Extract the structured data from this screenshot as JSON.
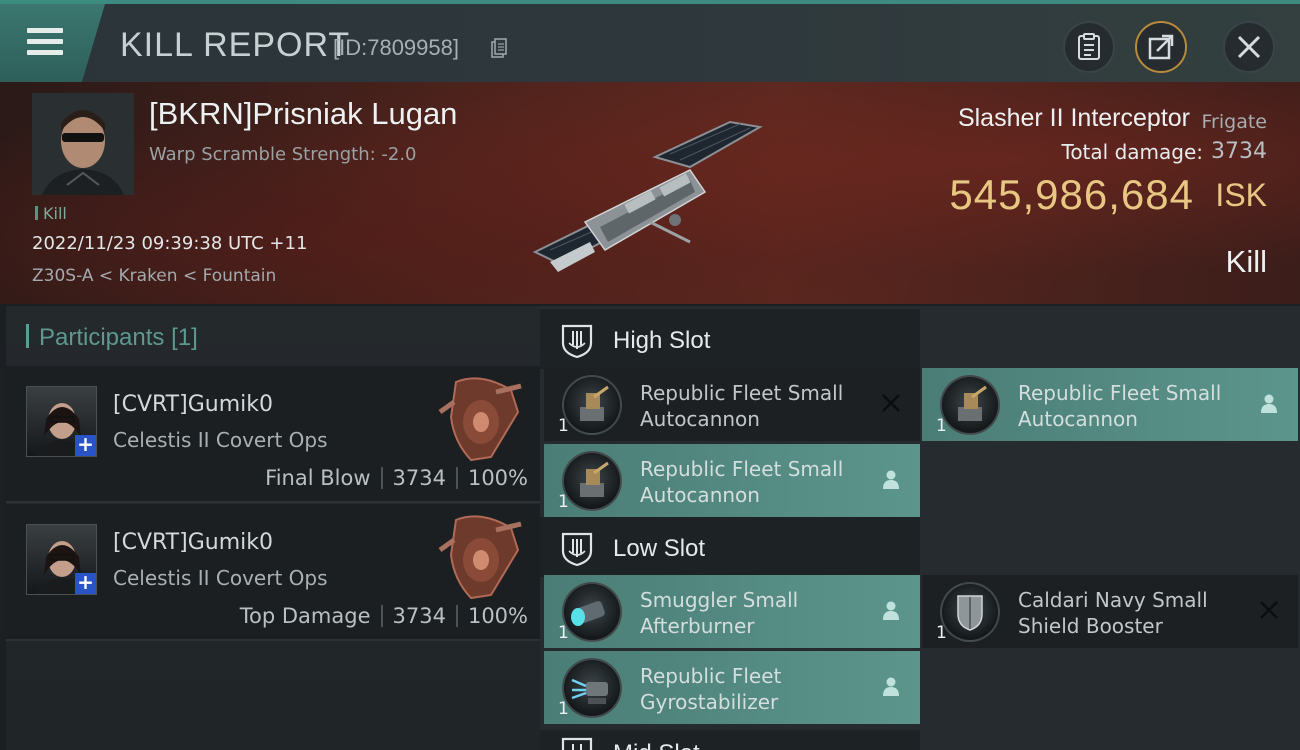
{
  "header": {
    "title": "KILL REPORT",
    "id_label": "[ID:7809958]"
  },
  "victim": {
    "name": "[BKRN]Prisniak Lugan",
    "scramble": "Warp Scramble Strength: -2.0",
    "kill_tag": "Kill",
    "datetime": "2022/11/23 09:39:38 UTC +11",
    "location": "Z30S-A < Kraken < Fountain",
    "ship_name": "Slasher II Interceptor",
    "ship_class": "Frigate",
    "total_damage_label": "Total damage:",
    "total_damage": "3734",
    "isk_value": "545,986,684",
    "isk_unit": "ISK",
    "result": "Kill"
  },
  "participants": {
    "title": "Participants",
    "count": "[1]",
    "rows": [
      {
        "name": "[CVRT]Gumik0",
        "ship": "Celestis II Covert Ops",
        "role": "Final Blow",
        "damage": "3734",
        "percent": "100%"
      },
      {
        "name": "[CVRT]Gumik0",
        "ship": "Celestis II Covert Ops",
        "role": "Top Damage",
        "damage": "3734",
        "percent": "100%"
      }
    ]
  },
  "slots": {
    "high": {
      "label": "High Slot",
      "modules": [
        {
          "qty": "1",
          "line1": "Republic Fleet Small",
          "line2": "Autocannon",
          "status": "destroyed"
        },
        {
          "qty": "1",
          "line1": "Republic Fleet Small",
          "line2": "Autocannon",
          "status": "dropped"
        },
        {
          "qty": "1",
          "line1": "Republic Fleet Small",
          "line2": "Autocannon",
          "status": "dropped"
        }
      ]
    },
    "low": {
      "label": "Low Slot",
      "modules": [
        {
          "qty": "1",
          "line1": "Smuggler Small",
          "line2": "Afterburner",
          "status": "dropped"
        },
        {
          "qty": "1",
          "line1": "Caldari Navy Small",
          "line2": "Shield Booster",
          "status": "destroyed"
        },
        {
          "qty": "1",
          "line1": "Republic Fleet",
          "line2": "Gyrostabilizer",
          "status": "dropped"
        }
      ]
    },
    "mid": {
      "label": "Mid Slot"
    }
  },
  "colors": {
    "accent_teal": "#3d8a80",
    "isk_gold": "#e8c782",
    "dropped_module_bg": "#5c958c"
  }
}
